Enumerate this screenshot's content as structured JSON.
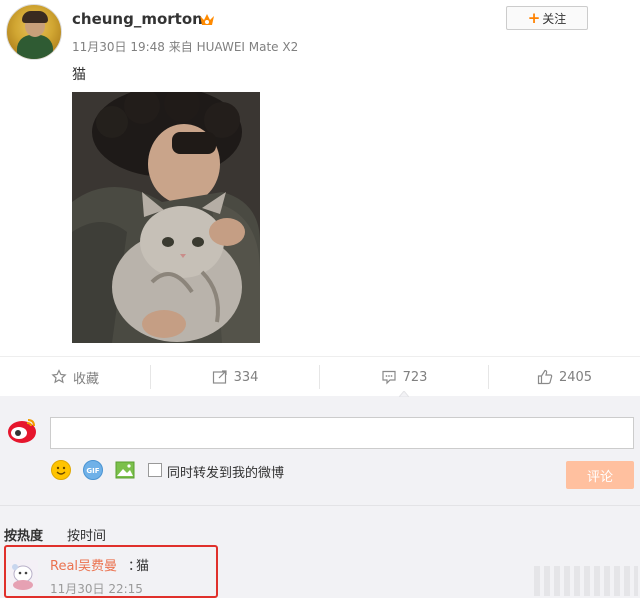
{
  "post": {
    "username": "cheung_morton",
    "time": "11月30日 19:48",
    "source_prefix": "来自",
    "device": "HUAWEI Mate X2",
    "text": "猫",
    "follow_label": "关注"
  },
  "actions": {
    "favorite_label": "收藏",
    "repost_count": "334",
    "comment_count": "723",
    "like_count": "2405"
  },
  "composer": {
    "input_value": "",
    "icons": [
      "emoji-icon",
      "gif-icon",
      "image-icon"
    ],
    "repost_label": "同时转发到我的微博",
    "submit_label": "评论"
  },
  "sort_tabs": [
    "按热度",
    "按时间"
  ],
  "comment": {
    "author": "Real吴费曼",
    "separator": "：",
    "text": "猫",
    "time": "11月30日 22:15"
  },
  "colors": {
    "accent": "#ff8200",
    "submit_bg": "#ffc09f",
    "comment_name": "#eb7350",
    "highlight_border": "#e0302b"
  }
}
